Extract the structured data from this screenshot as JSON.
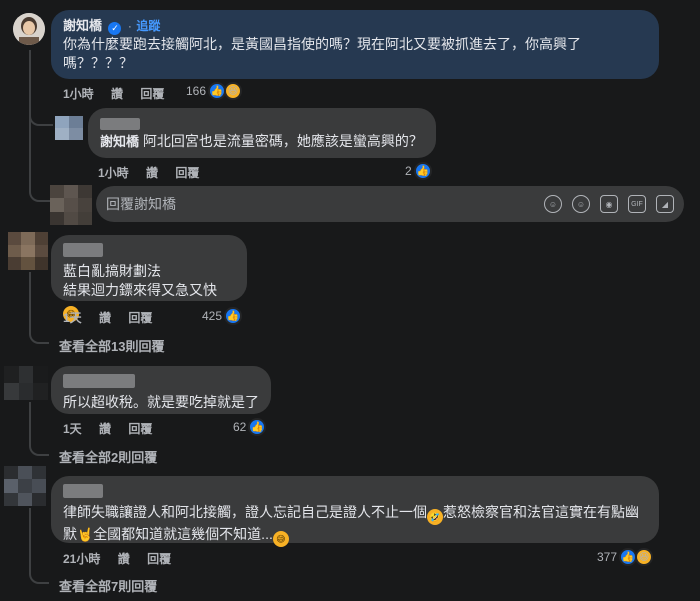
{
  "comments": [
    {
      "author": "謝知橋",
      "follow_label": "追蹤",
      "text_line1": "你為什麼要跑去接觸阿北，是黃國昌指使的嗎？現在阿北又要被抓進去了，你高興了",
      "text_line2": "嗎？？？？",
      "time": "1小時",
      "like_label": "讚",
      "reply_label": "回覆",
      "reactions": "166"
    },
    {
      "author": "謝知橋",
      "text": "阿北回宮也是流量密碼，她應該是蠻高興的？",
      "time": "1小時",
      "like_label": "讚",
      "reply_label": "回覆",
      "reactions": "2"
    },
    {
      "text_line1": "藍白亂搞財劃法",
      "text_line2": "結果迴力鏢來得又急又快",
      "time": "1天",
      "like_label": "讚",
      "reply_label": "回覆",
      "reactions": "425",
      "view_replies": "查看全部13則回覆"
    },
    {
      "text": "所以超收稅。就是要吃掉就是了",
      "time": "1天",
      "like_label": "讚",
      "reply_label": "回覆",
      "reactions": "62",
      "view_replies": "查看全部2則回覆"
    },
    {
      "text_line1": "律師失職讓證人和阿北接觸，證人忘記自己是證人不止一個",
      "text_line1b": "惹怒檢察官和法官這實在有點幽",
      "text_line2a": "默",
      "text_line2b": "全國都知道就這幾個不知道...",
      "time": "21小時",
      "like_label": "讚",
      "reply_label": "回覆",
      "reactions": "377",
      "view_replies": "查看全部7則回覆"
    }
  ],
  "reply_box": {
    "placeholder": "回覆謝知橋"
  },
  "colors": {
    "background": "#18191a",
    "bubble": "#3a3b3c",
    "highlight_bubble": "#263951",
    "accent": "#1877f2"
  }
}
